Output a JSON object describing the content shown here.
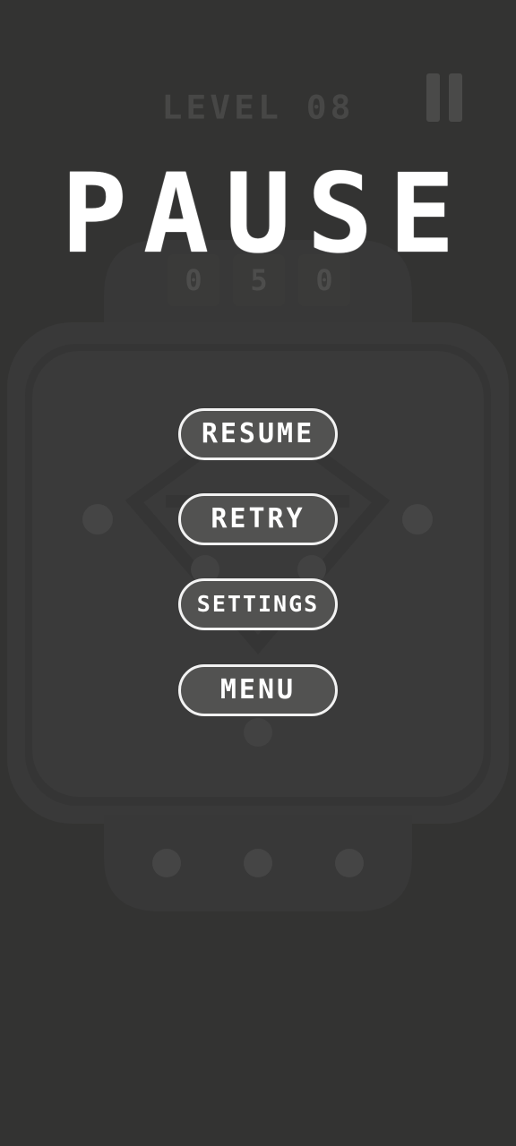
{
  "hud": {
    "level_label": "LEVEL 08",
    "timer_digits": [
      "0",
      "5",
      "0"
    ]
  },
  "overlay": {
    "title": "PAUSE",
    "buttons": {
      "resume": "RESUME",
      "retry": "RETRY",
      "settings": "SETTINGS",
      "menu": "MENU"
    }
  },
  "colors": {
    "background": "#333332",
    "device_body": "#3a3a3a",
    "button_fill": "#525251",
    "button_border": "#f2f2f2",
    "title": "#ffffff"
  },
  "icons": {
    "top_right": "pause-icon"
  }
}
